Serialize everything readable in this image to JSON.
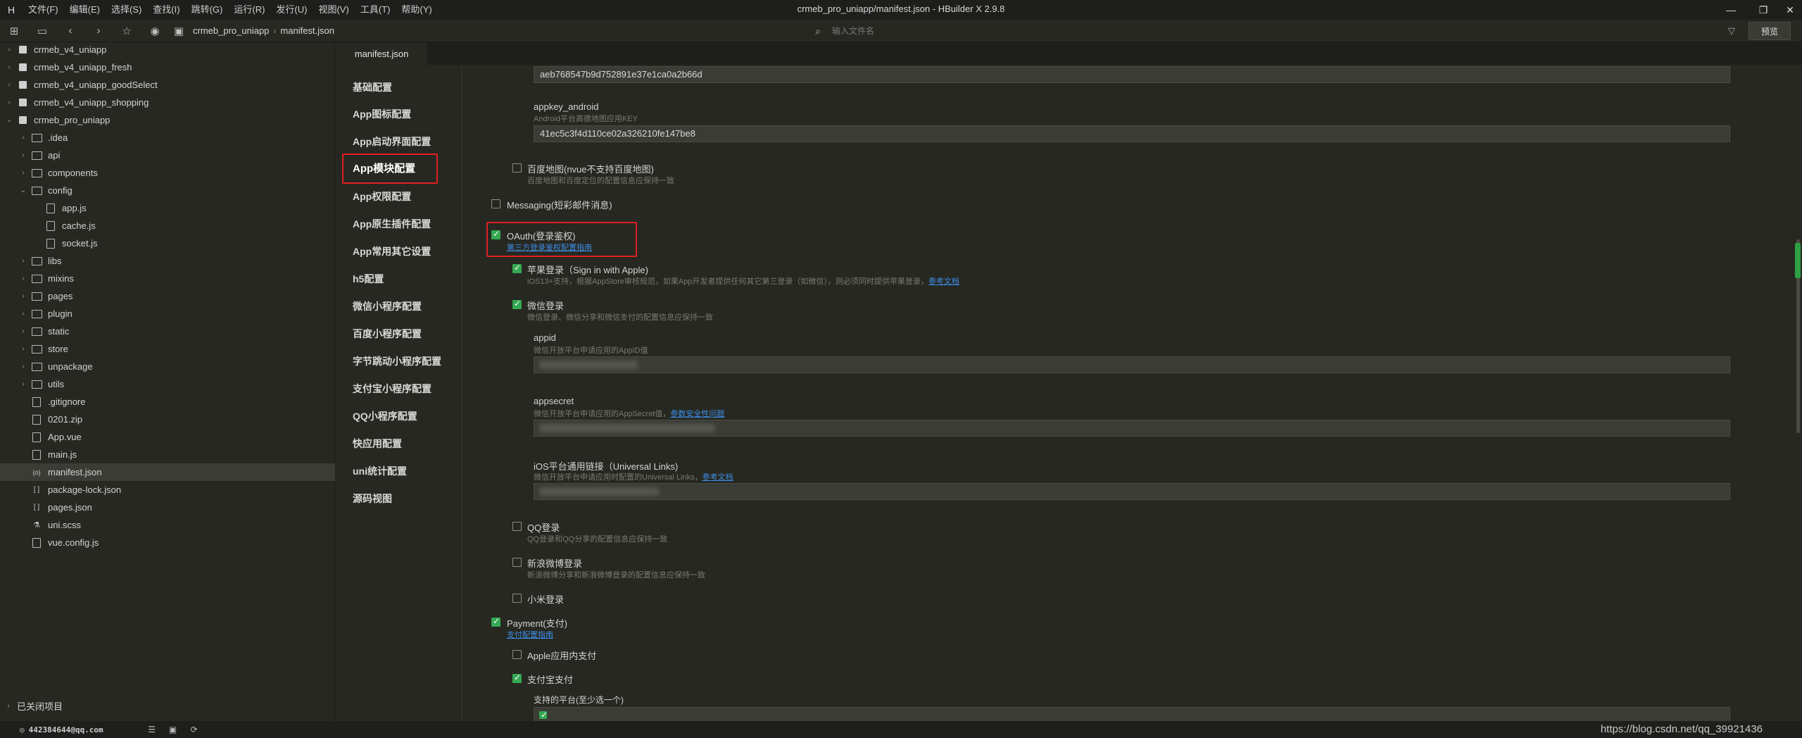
{
  "window": {
    "title": "crmeb_pro_uniapp/manifest.json - HBuilder X 2.9.8",
    "menu": [
      "文件(F)",
      "编辑(E)",
      "选择(S)",
      "查找(I)",
      "跳转(G)",
      "运行(R)",
      "发行(U)",
      "视图(V)",
      "工具(T)",
      "帮助(Y)"
    ],
    "controls": {
      "minimize": "—",
      "restore": "❐",
      "close": "✕"
    }
  },
  "toolbar": {
    "breadcrumb": [
      "crmeb_pro_uniapp",
      "manifest.json"
    ],
    "search_placeholder": "输入文件名",
    "preview_label": "预览"
  },
  "sidebar": {
    "tree": [
      {
        "label": "crmeb_v4_uniapp",
        "arrow": "›",
        "icon": "project"
      },
      {
        "label": "crmeb_v4_uniapp_fresh",
        "arrow": "›",
        "icon": "project"
      },
      {
        "label": "crmeb_v4_uniapp_goodSelect",
        "arrow": "›",
        "icon": "project"
      },
      {
        "label": "crmeb_v4_uniapp_shopping",
        "arrow": "›",
        "icon": "project"
      },
      {
        "label": "crmeb_pro_uniapp",
        "arrow": "⌄",
        "icon": "project"
      },
      {
        "label": ".idea",
        "arrow": "›",
        "icon": "folder"
      },
      {
        "label": "api",
        "arrow": "›",
        "icon": "folder"
      },
      {
        "label": "components",
        "arrow": "›",
        "icon": "folder"
      },
      {
        "label": "config",
        "arrow": "⌄",
        "icon": "folder"
      },
      {
        "label": "app.js",
        "arrow": "",
        "icon": "file"
      },
      {
        "label": "cache.js",
        "arrow": "",
        "icon": "file"
      },
      {
        "label": "socket.js",
        "arrow": "",
        "icon": "file"
      },
      {
        "label": "libs",
        "arrow": "›",
        "icon": "folder"
      },
      {
        "label": "mixins",
        "arrow": "›",
        "icon": "folder"
      },
      {
        "label": "pages",
        "arrow": "›",
        "icon": "folder"
      },
      {
        "label": "plugin",
        "arrow": "›",
        "icon": "folder"
      },
      {
        "label": "static",
        "arrow": "›",
        "icon": "folder"
      },
      {
        "label": "store",
        "arrow": "›",
        "icon": "folder"
      },
      {
        "label": "unpackage",
        "arrow": "›",
        "icon": "folder"
      },
      {
        "label": "utils",
        "arrow": "›",
        "icon": "folder"
      },
      {
        "label": ".gitignore",
        "arrow": "",
        "icon": "file"
      },
      {
        "label": "0201.zip",
        "arrow": "",
        "icon": "file"
      },
      {
        "label": "App.vue",
        "arrow": "",
        "icon": "file"
      },
      {
        "label": "main.js",
        "arrow": "",
        "icon": "file"
      },
      {
        "label": "manifest.json",
        "arrow": "",
        "icon": "brace"
      },
      {
        "label": "package-lock.json",
        "arrow": "",
        "icon": "brackets"
      },
      {
        "label": "pages.json",
        "arrow": "",
        "icon": "brackets"
      },
      {
        "label": "uni.scss",
        "arrow": "",
        "icon": "link"
      },
      {
        "label": "vue.config.js",
        "arrow": "",
        "icon": "file"
      }
    ],
    "closed_projects": "已关闭项目"
  },
  "statusbar": {
    "user": "442384644@qq.com",
    "watermark": "https://blog.csdn.net/qq_39921436"
  },
  "editor": {
    "tab": "manifest.json",
    "nav": [
      "基础配置",
      "App图标配置",
      "App启动界面配置",
      "App模块配置",
      "App权限配置",
      "App原生插件配置",
      "App常用其它设置",
      "h5配置",
      "微信小程序配置",
      "百度小程序配置",
      "字节跳动小程序配置",
      "支付宝小程序配置",
      "QQ小程序配置",
      "快应用配置",
      "uni统计配置",
      "源码视图"
    ],
    "active_nav": "App模块配置"
  },
  "content": {
    "appkey_ios_value": "aeb768547b9d752891e37e1ca0a2b66d",
    "appkey_android_label": "appkey_android",
    "appkey_android_desc": "Android平台高德地图应用KEY",
    "appkey_android_value": "41ec5c3f4d110ce02a326210fe147be8",
    "baidu_map_label": "百度地图(nvue不支持百度地图)",
    "baidu_map_desc": "百度地图和百度定位的配置信息应保持一致",
    "messaging_label": "Messaging(短彩邮件消息)",
    "oauth_label": "OAuth(登录鉴权)",
    "oauth_link": "第三方登录鉴权配置指南",
    "apple_label": "苹果登录（Sign in with Apple)",
    "apple_desc": "iOS13+支持，根据AppStore审核规范，如果App开发者提供任何其它第三登录（如微信），则必须同时提供苹果登录，",
    "apple_desc_link": "参考文档",
    "wechat_label": "微信登录",
    "wechat_desc": "微信登录、微信分享和微信支付的配置信息应保持一致",
    "appid_label": "appid",
    "appid_desc": "微信开放平台申请应用的AppID值",
    "appsecret_label": "appsecret",
    "appsecret_desc": "微信开放平台申请应用的AppSecret值，",
    "appsecret_link": "参数安全性问题",
    "universal_label": "iOS平台通用链接（Universal Links)",
    "universal_desc": "微信开放平台申请应用时配置的Universal Links，",
    "universal_link": "参考文档",
    "qq_label": "QQ登录",
    "qq_desc": "QQ登录和QQ分享的配置信息应保持一致",
    "weibo_label": "新浪微博登录",
    "weibo_desc": "新浪微博分享和新浪微博登录的配置信息应保持一致",
    "xiaomi_label": "小米登录",
    "payment_label": "Payment(支付)",
    "payment_link": "支付配置指南",
    "apple_pay_label": "Apple应用内支付",
    "alipay_label": "支付宝支付",
    "platforms_label": "支持的平台(至少选一个)"
  },
  "colors": {
    "accent_green": "#34a853",
    "highlight_red": "#e02020",
    "link_blue": "#3d8ee6"
  }
}
